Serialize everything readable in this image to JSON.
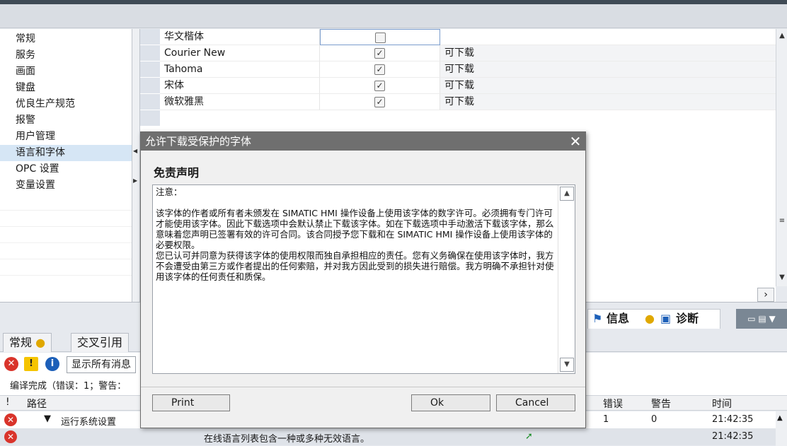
{
  "nav": {
    "items": [
      "常规",
      "服务",
      "画面",
      "键盘",
      "优良生产规范",
      "报警",
      "用户管理",
      "语言和字体",
      "OPC 设置",
      "变量设置"
    ],
    "selected_index": 7
  },
  "fonts": {
    "rows": [
      {
        "name": "华文楷体",
        "checked": false,
        "download": ""
      },
      {
        "name": "Courier New",
        "checked": true,
        "download": "可下载"
      },
      {
        "name": "Tahoma",
        "checked": true,
        "download": "可下载"
      },
      {
        "name": "宋体",
        "checked": true,
        "download": "可下载"
      },
      {
        "name": "微软雅黑",
        "checked": true,
        "download": "可下载"
      }
    ],
    "check_mark": "✓"
  },
  "bottom": {
    "info_tab": "信息",
    "diag_tab": "诊断",
    "tab_general": "常规",
    "tab_xref": "交叉引用",
    "show_all": "显示所有消息",
    "compile_status": "编译完成（错误：1；警告：",
    "grid_headers": {
      "mark": "!",
      "path": "路径",
      "errors": "错误",
      "warnings": "警告",
      "time": "时间"
    },
    "rows": [
      {
        "path": "运行系统设置",
        "errors": "1",
        "warnings": "0",
        "time": "21:42:35",
        "desc": ""
      },
      {
        "path": "",
        "errors": "",
        "warnings": "",
        "time": "21:42:35",
        "desc": "在线语言列表包含一种或多种无效语言。"
      }
    ]
  },
  "dialog": {
    "title": "允许下载受保护的字体",
    "close": "✕",
    "heading": "免责声明",
    "note_label": "注意：",
    "paragraph1": "该字体的作者或所有者未颁发在 SIMATIC HMI 操作设备上使用该字体的数字许可。必须拥有专门许可才能使用该字体。因此下载选项中会默认禁止下载该字体。如在下载选项中手动激活下载该字体，那么意味着您声明已签署有效的许可合同。该合同授予您下载和在 SIMATIC HMI 操作设备上使用该字体的必要权限。",
    "paragraph2": "您已认可并同意为获得该字体的使用权限而独自承担相应的责任。您有义务确保在使用该字体时，我方不会遭受由第三方或作者提出的任何索赔，并对我方因此受到的损失进行赔偿。我方明确不承担针对使用该字体的任何责任和质保。",
    "print_label": "Print",
    "ok_label": "Ok",
    "cancel_label": "Cancel"
  },
  "colors": {
    "error": "#d9342b",
    "warning": "#f5c400",
    "info": "#1c5fb8",
    "selected": "#d6e6f5"
  }
}
